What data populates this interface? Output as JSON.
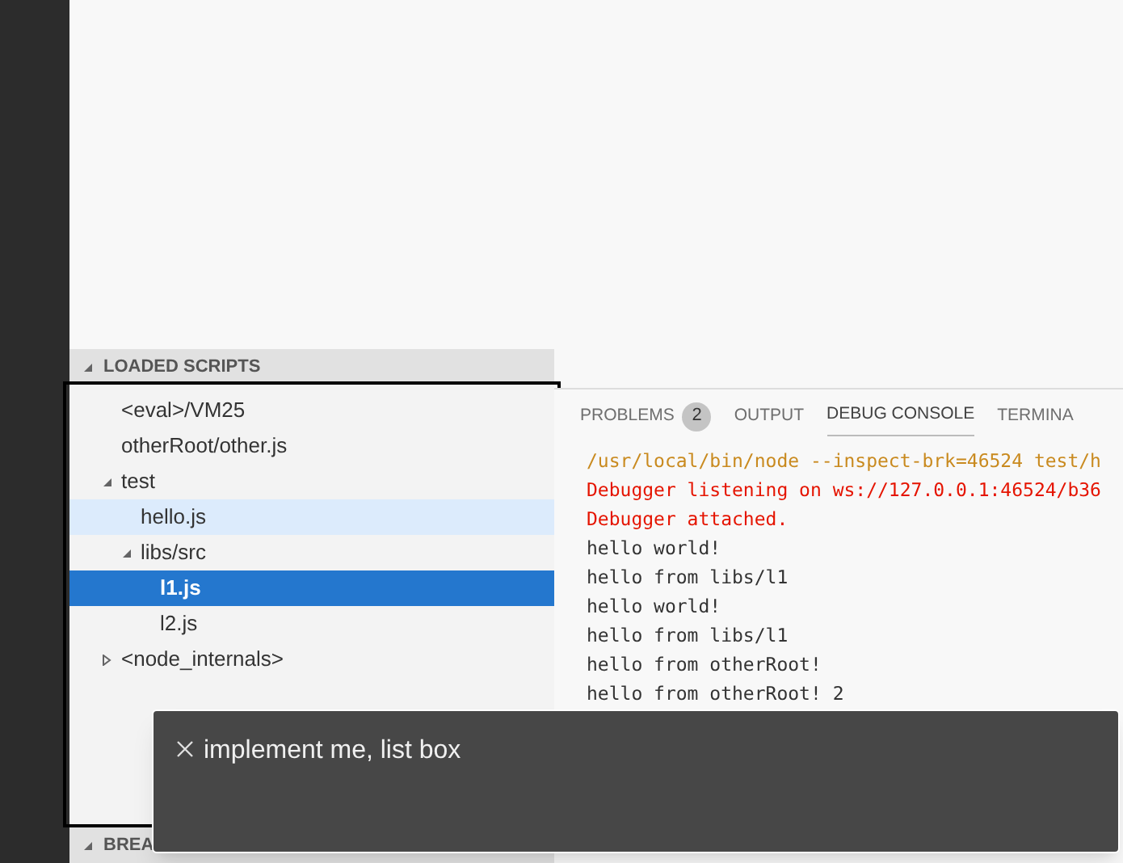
{
  "sidebar": {
    "loaded_scripts": {
      "title": "LOADED SCRIPTS",
      "expanded": true,
      "items": [
        {
          "label": "<eval>/VM25",
          "selected": false,
          "hovered": false
        },
        {
          "label": "otherRoot/other.js",
          "selected": false,
          "hovered": false
        },
        {
          "label": "test",
          "selected": false,
          "hovered": false,
          "expanded": true,
          "children": [
            {
              "label": "hello.js",
              "selected": false,
              "hovered": true
            },
            {
              "label": "libs/src",
              "selected": false,
              "hovered": false,
              "expanded": true,
              "children": [
                {
                  "label": "l1.js",
                  "selected": true,
                  "hovered": false
                },
                {
                  "label": "l2.js",
                  "selected": false,
                  "hovered": false
                }
              ]
            }
          ]
        },
        {
          "label": "<node_internals>",
          "selected": false,
          "hovered": false,
          "expanded": false
        }
      ]
    },
    "breakpoints": {
      "title": "BREA",
      "expanded": true
    }
  },
  "panel": {
    "tabs": [
      {
        "label": "PROBLEMS",
        "badge": "2",
        "selected": false
      },
      {
        "label": "OUTPUT",
        "selected": false
      },
      {
        "label": "DEBUG CONSOLE",
        "selected": true
      },
      {
        "label": "TERMINA",
        "selected": false
      }
    ],
    "lines": [
      {
        "kind": "command",
        "text": "/usr/local/bin/node --inspect-brk=46524 test/h"
      },
      {
        "kind": "error",
        "text": "Debugger listening on ws://127.0.0.1:46524/b36"
      },
      {
        "kind": "error",
        "text": "Debugger attached."
      },
      {
        "kind": "log",
        "text": "hello world!"
      },
      {
        "kind": "log",
        "text": "hello from libs/l1"
      },
      {
        "kind": "log",
        "text": "hello world!"
      },
      {
        "kind": "log",
        "text": "hello from libs/l1"
      },
      {
        "kind": "log",
        "text": "hello from otherRoot!"
      },
      {
        "kind": "log",
        "text": "hello from otherRoot! 2"
      }
    ]
  },
  "notification": {
    "message": "implement me, list box"
  }
}
